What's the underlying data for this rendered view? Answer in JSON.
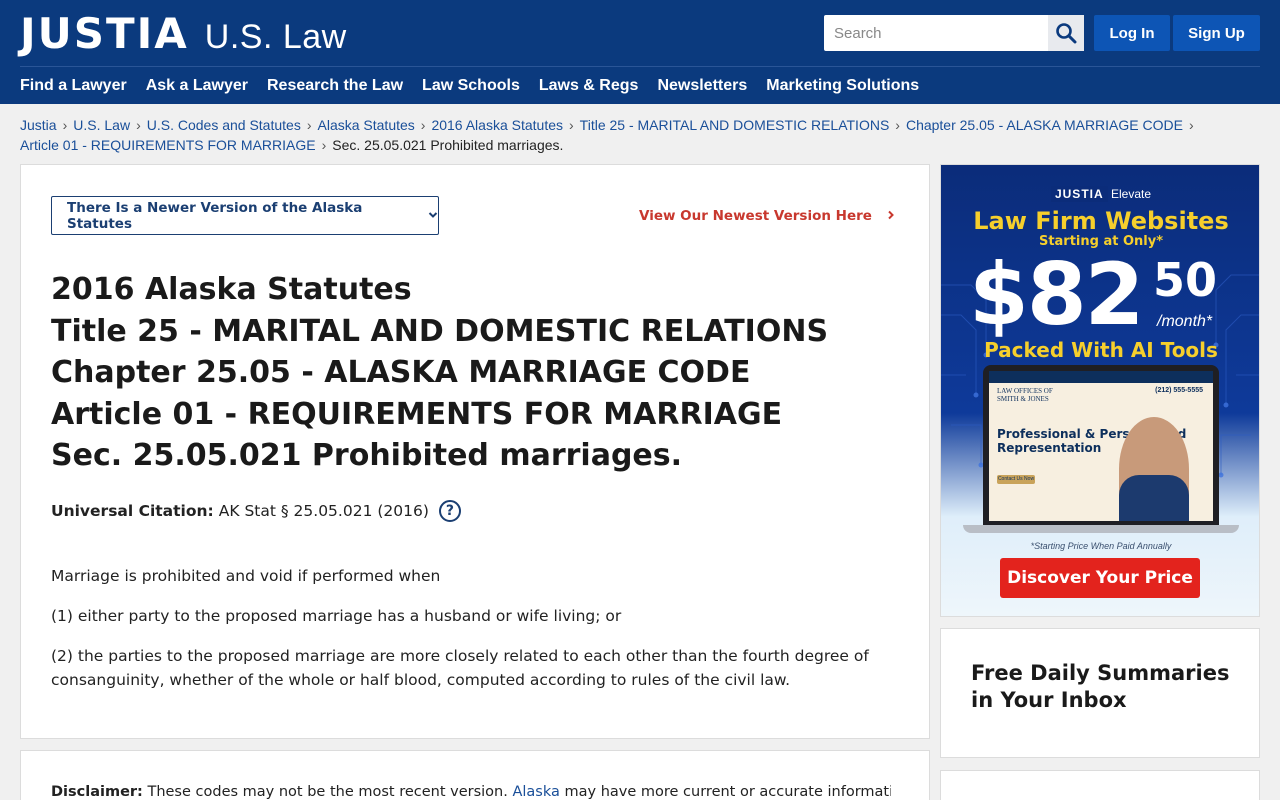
{
  "header": {
    "logo_mark": "JUSTIA",
    "logo_sub": "U.S. Law",
    "search_placeholder": "Search",
    "login_label": "Log In",
    "signup_label": "Sign Up",
    "nav": [
      "Find a Lawyer",
      "Ask a Lawyer",
      "Research the Law",
      "Law Schools",
      "Laws & Regs",
      "Newsletters",
      "Marketing Solutions"
    ]
  },
  "breadcrumb": {
    "items": [
      "Justia",
      "U.S. Law",
      "U.S. Codes and Statutes",
      "Alaska Statutes",
      "2016 Alaska Statutes",
      "Title 25 - MARITAL AND DOMESTIC RELATIONS",
      "Chapter 25.05 - ALASKA MARRIAGE CODE",
      "Article 01 - REQUIREMENTS FOR MARRIAGE"
    ],
    "current": "Sec. 25.05.021 Prohibited marriages."
  },
  "main": {
    "version_button": "There Is a Newer Version of the Alaska Statutes",
    "newest_link": "View Our Newest Version Here",
    "headings": [
      "2016 Alaska Statutes",
      "Title 25 - MARITAL AND DOMESTIC RELATIONS",
      "Chapter 25.05 - ALASKA MARRIAGE CODE",
      "Article 01 - REQUIREMENTS FOR MARRIAGE",
      "Sec. 25.05.021 Prohibited marriages."
    ],
    "citation_label": "Universal Citation:",
    "citation_value": "AK Stat § 25.05.021 (2016)",
    "help_icon": "?",
    "paragraphs": [
      "Marriage is prohibited and void if performed when",
      "(1) either party to the proposed marriage has a husband or wife living; or",
      "(2) the parties to the proposed marriage are more closely related to each other than the fourth degree of consanguinity, whether of the whole or half blood, computed according to rules of the civil law."
    ]
  },
  "disclaimer": {
    "label": "Disclaimer:",
    "text_before": "These codes may not be the most recent version.",
    "link": "Alaska",
    "text_after": "may have more current or accurate information. We make"
  },
  "ad": {
    "brand": "JUSTIA",
    "brand_sub": "Elevate",
    "title": "Law Firm Websites",
    "starting": "Starting at Only*",
    "price": "$82",
    "cents": "50",
    "per": "/month*",
    "tools": "Packed With AI Tools",
    "screen_firm_line1": "LAW OFFICES OF",
    "screen_firm_line2": "SMITH & JONES",
    "screen_phone": "(212) 555-5555",
    "screen_hero": "Professional & Personalized Representation",
    "screen_cta": "Contact Us Now",
    "note": "*Starting Price When Paid Annually",
    "cta": "Discover Your Price"
  },
  "sidebar": {
    "summary_title": "Free Daily Summaries in Your Inbox"
  },
  "colors": {
    "header_bg": "#0b3a7e",
    "button_blue": "#0d55b5",
    "link_blue": "#1a4f99",
    "accent_red": "#c8382e",
    "ad_cta_red": "#e3231d",
    "ad_yellow": "#f6cf2c"
  }
}
